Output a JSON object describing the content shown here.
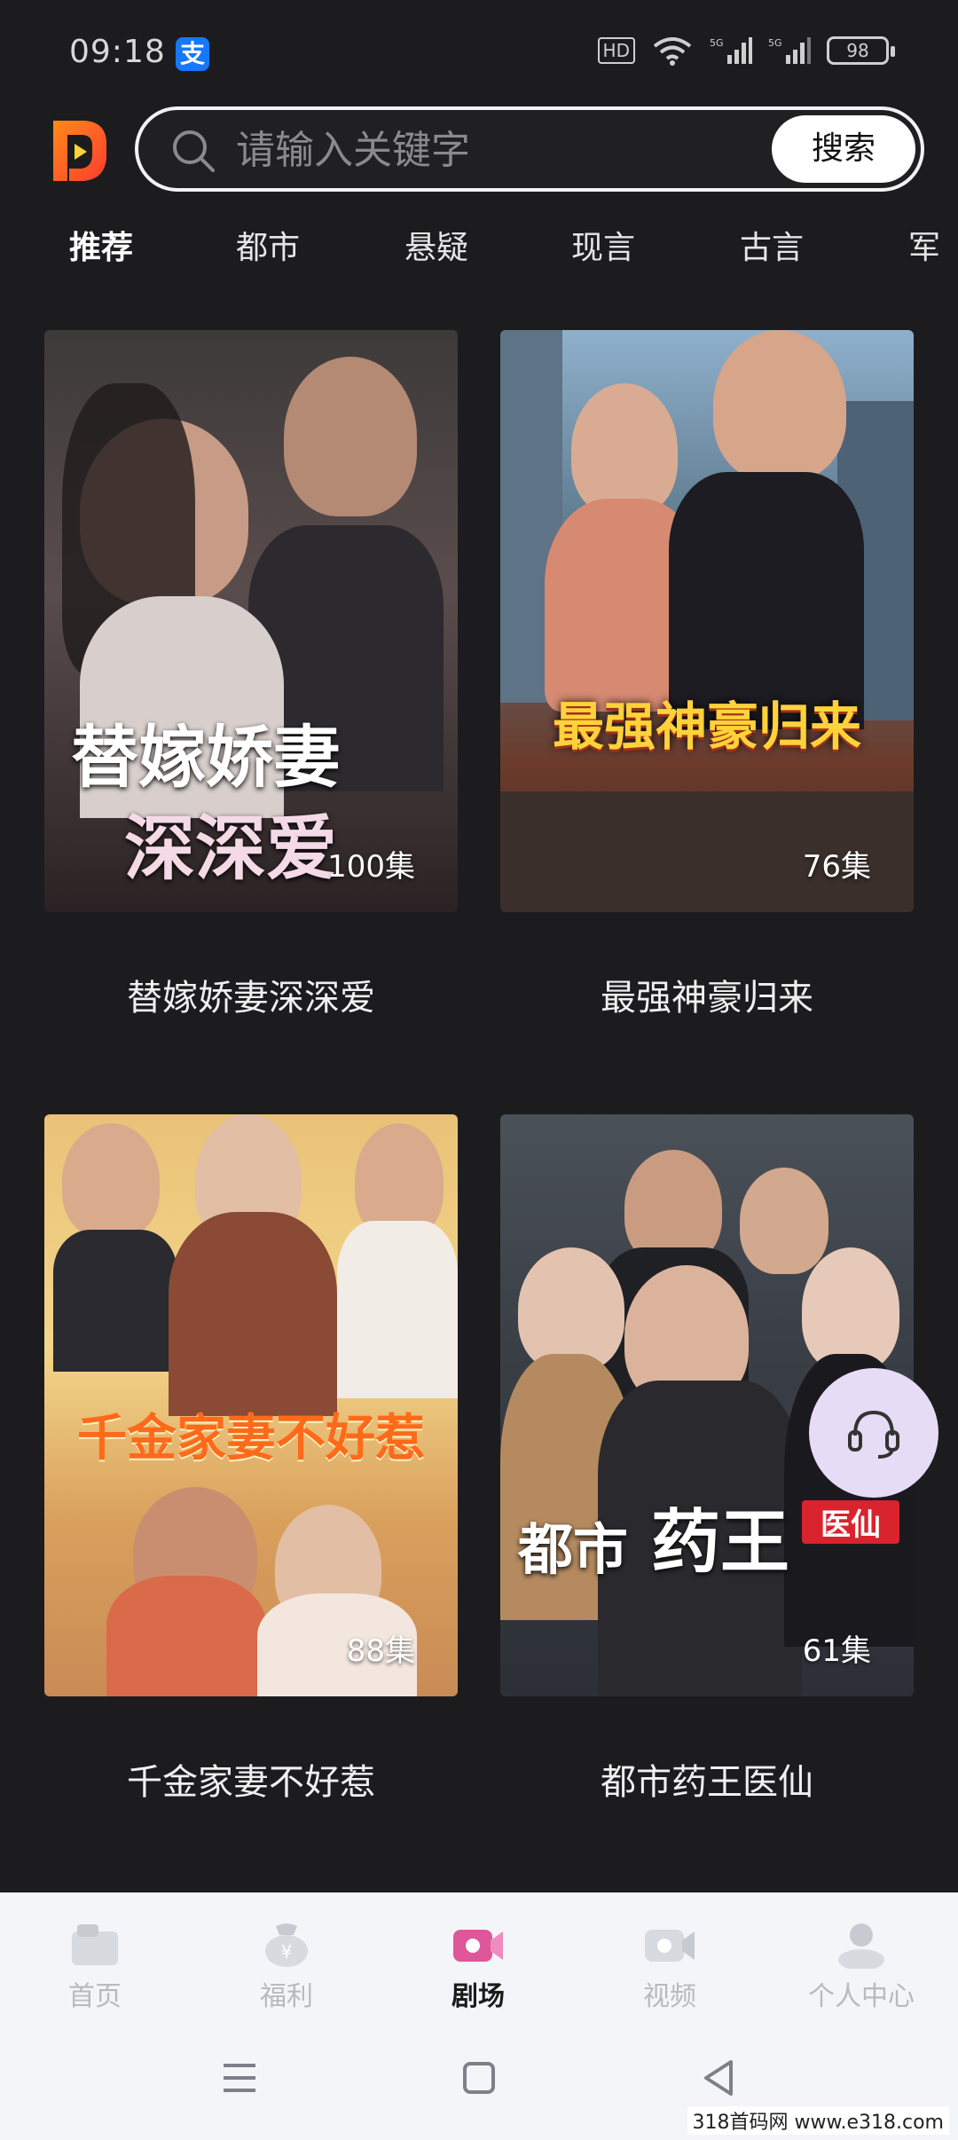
{
  "status_bar": {
    "time": "09:18",
    "notification_icon_text": "支",
    "hd_badge": "HD",
    "signal_1": "5G",
    "signal_2": "5G",
    "battery": "98"
  },
  "search": {
    "placeholder": "请输入关键字",
    "button_label": "搜索"
  },
  "tabs": [
    "推荐",
    "都市",
    "悬疑",
    "现言",
    "古言",
    "军"
  ],
  "active_tab": "推荐",
  "dramas": [
    {
      "title": "替嫁娇妻深深爱",
      "episodes": "100集",
      "poster_text_1": "替嫁娇妻",
      "poster_text_2": "深深爱"
    },
    {
      "title": "最强神豪归来",
      "episodes": "76集",
      "poster_text_1": "最强神豪归来"
    },
    {
      "title": "千金家妻不好惹",
      "episodes": "88集",
      "poster_text_1": "千金家妻不好惹"
    },
    {
      "title": "都市药王医仙",
      "episodes": "61集",
      "poster_text_1": "都市",
      "poster_text_2": "药王",
      "poster_text_3": "医仙"
    }
  ],
  "bottom_nav": [
    {
      "label": "首页",
      "icon": "home-icon"
    },
    {
      "label": "福利",
      "icon": "welfare-icon"
    },
    {
      "label": "剧场",
      "icon": "theater-icon"
    },
    {
      "label": "视频",
      "icon": "video-icon"
    },
    {
      "label": "个人中心",
      "icon": "profile-icon"
    }
  ],
  "active_nav": "剧场",
  "watermark": "318首码网 www.e318.com",
  "colors": {
    "background": "#1c1c1e",
    "accent": "#e0569a",
    "logo_orange": "#ff6a1a",
    "support_fab": "#e6dcf6"
  }
}
